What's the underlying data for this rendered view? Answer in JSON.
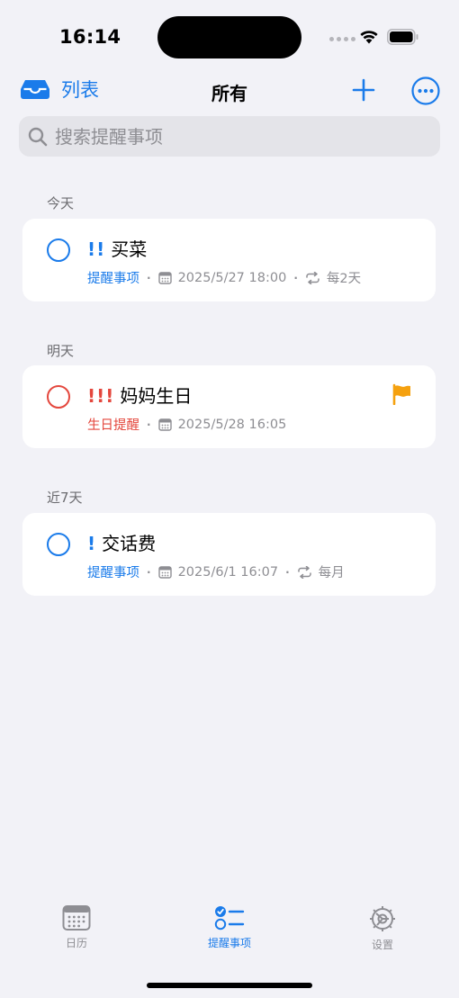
{
  "status_bar": {
    "time": "16:14"
  },
  "nav": {
    "lists_label": "列表",
    "title": "所有"
  },
  "search": {
    "placeholder": "搜索提醒事项"
  },
  "sections": [
    {
      "header": "今天",
      "item": {
        "priority": "!!",
        "title": "买菜",
        "list": "提醒事项",
        "datetime": "2025/5/27 18:00",
        "repeat": "每2天",
        "flagged": false
      }
    },
    {
      "header": "明天",
      "item": {
        "priority": "!!!",
        "title": "妈妈生日",
        "list": "生日提醒",
        "datetime": "2025/5/28 16:05",
        "flagged": true
      }
    },
    {
      "header": "近7天",
      "item": {
        "priority": "!",
        "title": "交话费",
        "list": "提醒事项",
        "datetime": "2025/6/1 16:07",
        "repeat": "每月",
        "flagged": false
      }
    }
  ],
  "tabs": [
    {
      "label": "日历",
      "icon": "calendar-icon"
    },
    {
      "label": "提醒事项",
      "icon": "checklist-icon",
      "active": true
    },
    {
      "label": "设置",
      "icon": "gear-icon"
    }
  ],
  "colors": {
    "accent": "#1a7bea",
    "red": "#e4473d",
    "flag": "#f5a10f",
    "background": "#f2f2f7"
  }
}
